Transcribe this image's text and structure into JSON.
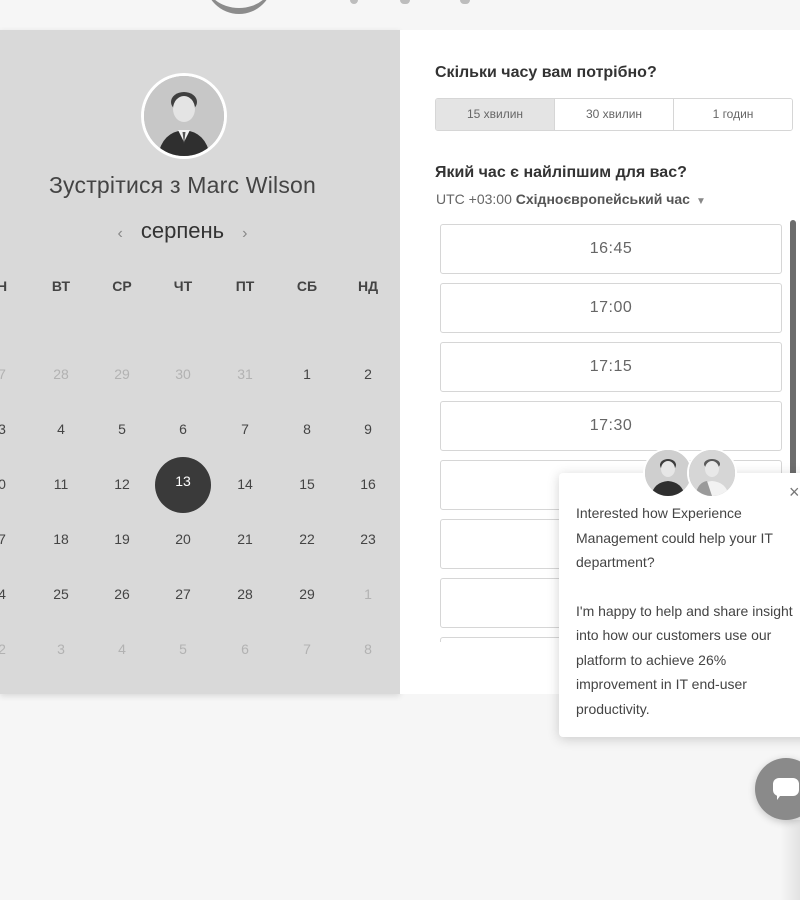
{
  "calendar": {
    "meet_title": "Зустрітися з Marc Wilson",
    "month": "серпень",
    "prev_arrow": "‹",
    "next_arrow": "›",
    "weekdays": [
      "Н",
      "ВТ",
      "СР",
      "ЧТ",
      "ПТ",
      "СБ",
      "НД"
    ],
    "weeks": [
      [
        "7",
        "28",
        "29",
        "30",
        "31",
        "1",
        "2"
      ],
      [
        "3",
        "4",
        "5",
        "6",
        "7",
        "8",
        "9"
      ],
      [
        "0",
        "11",
        "12",
        "13",
        "14",
        "15",
        "16"
      ],
      [
        "7",
        "18",
        "19",
        "20",
        "21",
        "22",
        "23"
      ],
      [
        "4",
        "25",
        "26",
        "27",
        "28",
        "29",
        "1"
      ],
      [
        "2",
        "3",
        "4",
        "5",
        "6",
        "7",
        "8"
      ]
    ],
    "selected_day": "13"
  },
  "scheduler": {
    "duration_question": "Скільки часу вам потрібно?",
    "durations": [
      "15 хвилин",
      "30 хвилин",
      "1 годин"
    ],
    "selected_duration": "15 хвилин",
    "time_question": "Який час є найліпшим для вас?",
    "timezone_offset": "UTC +03:00",
    "timezone_name": "Східноєвропейський час",
    "slots": [
      "16:45",
      "17:00",
      "17:15",
      "17:30",
      "",
      "",
      "",
      ""
    ]
  },
  "chat": {
    "close_glyph": "×",
    "message_1": "Interested how Experience Management could help your IT department?",
    "message_2": "I'm happy to help and share insight into how our customers use our platform to achieve 26% improvement in IT end-user productivity."
  },
  "icons": {
    "avatar": "person-photo",
    "chat_launcher": "chat-bubble-icon",
    "timezone_caret": "caret-down-icon"
  },
  "colors": {
    "panel_bg": "#d9d9d9",
    "selected_day": "#3a3a3a",
    "accent_grey": "#8a8a8a"
  }
}
